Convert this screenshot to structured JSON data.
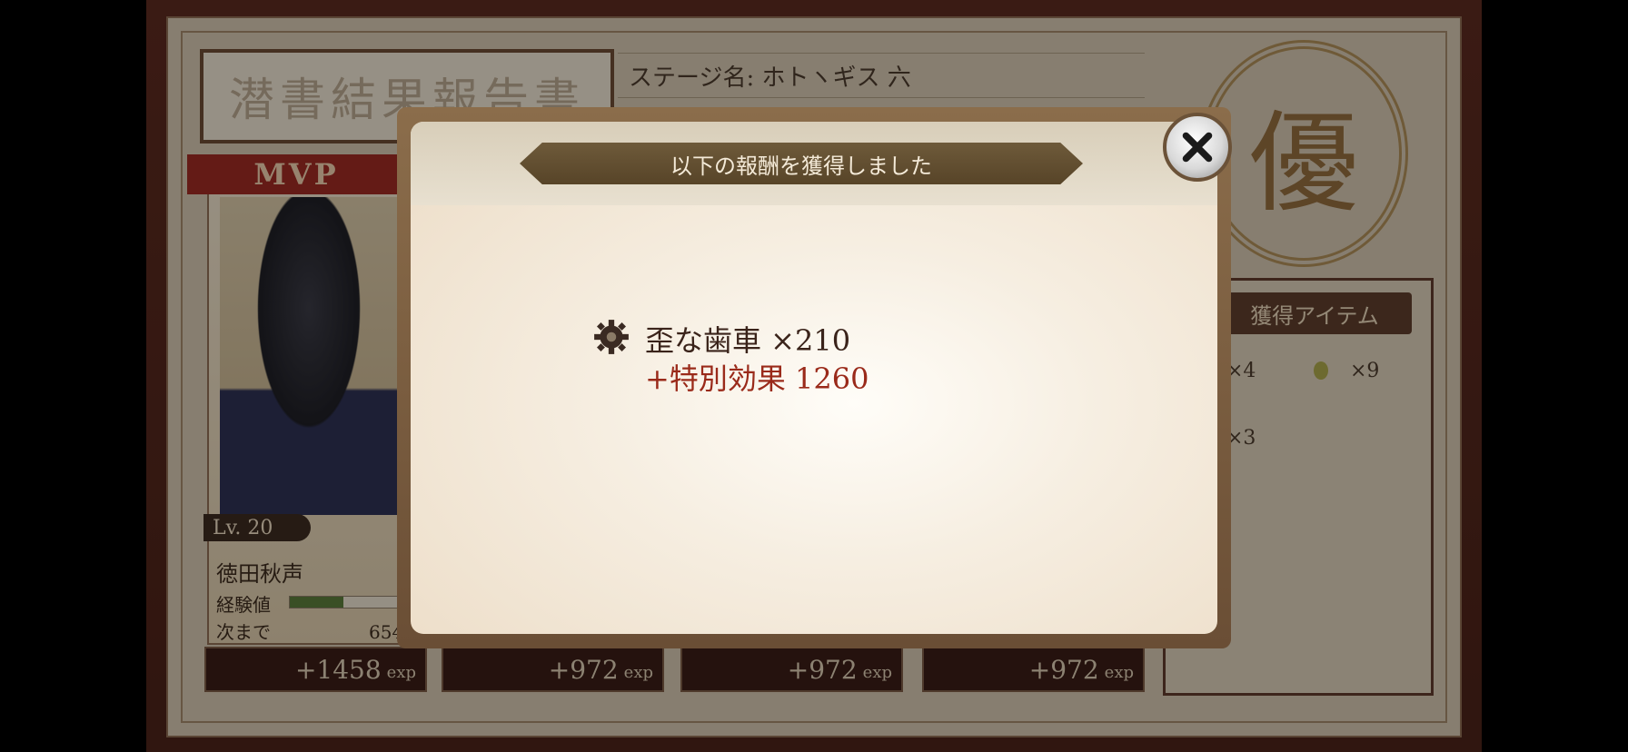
{
  "report": {
    "title": "潜書結果報告書",
    "stage_label": "ステージ名: ホトヽギス 六",
    "grade": "優",
    "mvp_label": "MVP"
  },
  "character": {
    "level": "Lv. 20",
    "name": "徳田秋声",
    "exp_label": "経験値",
    "exp_progress": 0.5,
    "next_label": "次まで",
    "next_value": "654"
  },
  "exp_gains": [
    {
      "value": "+1458",
      "unit": "exp"
    },
    {
      "value": "+972",
      "unit": "exp"
    },
    {
      "value": "+972",
      "unit": "exp"
    },
    {
      "value": "+972",
      "unit": "exp"
    }
  ],
  "items_panel": {
    "header": "獲得アイテム",
    "counts": [
      "×4",
      "×9",
      "×3"
    ]
  },
  "modal": {
    "title": "以下の報酬を獲得しました",
    "reward": {
      "icon": "gear-icon",
      "name": "歪な歯車 ×210",
      "bonus": "+特別効果 1260"
    },
    "close_icon": "close-icon"
  }
}
